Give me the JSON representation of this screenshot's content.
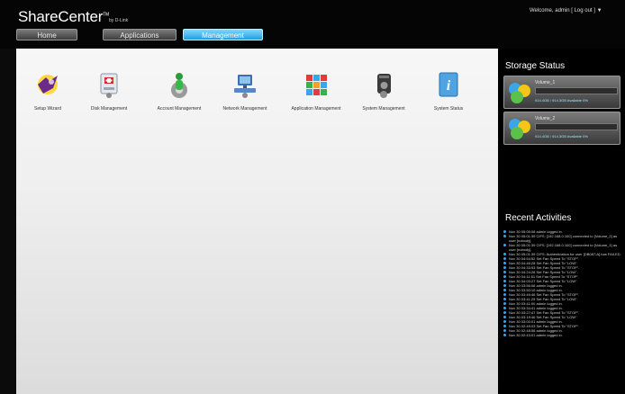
{
  "header": {
    "logo": "ShareCenter",
    "logo_tm": "TM",
    "logo_by": "by D-Link",
    "welcome_prefix": "Welcome, admin",
    "logout_label": "[ Log out ]",
    "menu_arrow": "▼"
  },
  "tabs": [
    {
      "label": "Home",
      "active": false
    },
    {
      "label": "Applications",
      "active": false
    },
    {
      "label": "Management",
      "active": true
    }
  ],
  "tools": [
    {
      "label": "Setup Wizard",
      "icon": "setup-wizard-icon"
    },
    {
      "label": "Disk Management",
      "icon": "disk-management-icon"
    },
    {
      "label": "Account Management",
      "icon": "account-management-icon"
    },
    {
      "label": "Network Management",
      "icon": "network-management-icon"
    },
    {
      "label": "Application Management",
      "icon": "application-management-icon"
    },
    {
      "label": "System Management",
      "icon": "system-management-icon"
    },
    {
      "label": "System Status",
      "icon": "system-status-icon"
    }
  ],
  "storage": {
    "title": "Storage Status",
    "volumes": [
      {
        "name": "Volume_1",
        "capacity": "914.4GB / 914.3GB Available  0%",
        "used_fraction": 0
      },
      {
        "name": "Volume_2",
        "capacity": "914.4GB / 914.3GB Available  0%",
        "used_fraction": 0
      }
    ]
  },
  "activities": {
    "title": "Recent Activities",
    "items": [
      "Nov 30 05:05:08 admin logged in.",
      "Nov 30 05:01:39 CIFS: [192.168.0.100] connected to [Volume_2] as user [nobody].",
      "Nov 30 05:01:39 CIFS: [192.168.0.100] connected to [Volume_1] as user [nobody].",
      "Nov 30 05:01:39 CIFS: Authentication for user [DB087-A] has FAILED.",
      "Nov 30 04:54:52 Set Fan Speed To \"STOP\".",
      "Nov 30 04:46:28 Set Fan Speed To \"LOW\".",
      "Nov 30 04:33:53 Set Fan Speed To \"STOP\".",
      "Nov 30 04:24:26 Set Fan Speed To \"LOW\".",
      "Nov 30 04:11:51 Set Fan Speed To \"STOP\".",
      "Nov 30 04:03:27 Set Fan Speed To \"LOW\".",
      "Nov 30 03:56:08 admin logged in.",
      "Nov 30 03:50:10 admin logged in.",
      "Nov 30 03:49:46 Set Fan Speed To \"STOP\".",
      "Nov 30 03:41:25 Set Fan Speed To \"LOW\".",
      "Nov 30 03:41:00 admin logged in.",
      "Nov 30 03:34:41 admin logged in.",
      "Nov 30 03:27:47 Set Fan Speed To \"STOP\".",
      "Nov 30 03:19:46 Set Fan Speed To \"LOW\".",
      "Nov 30 03:00:01 admin logged in.",
      "Nov 30 02:49:03 Set Fan Speed To \"STOP\".",
      "Nov 30 02:48:58 admin logged in.",
      "Nov 30 02:43:01 admin logged in."
    ]
  },
  "colors": {
    "accent": "#1fa0de",
    "activity_bullet": "#2fa8ff"
  }
}
